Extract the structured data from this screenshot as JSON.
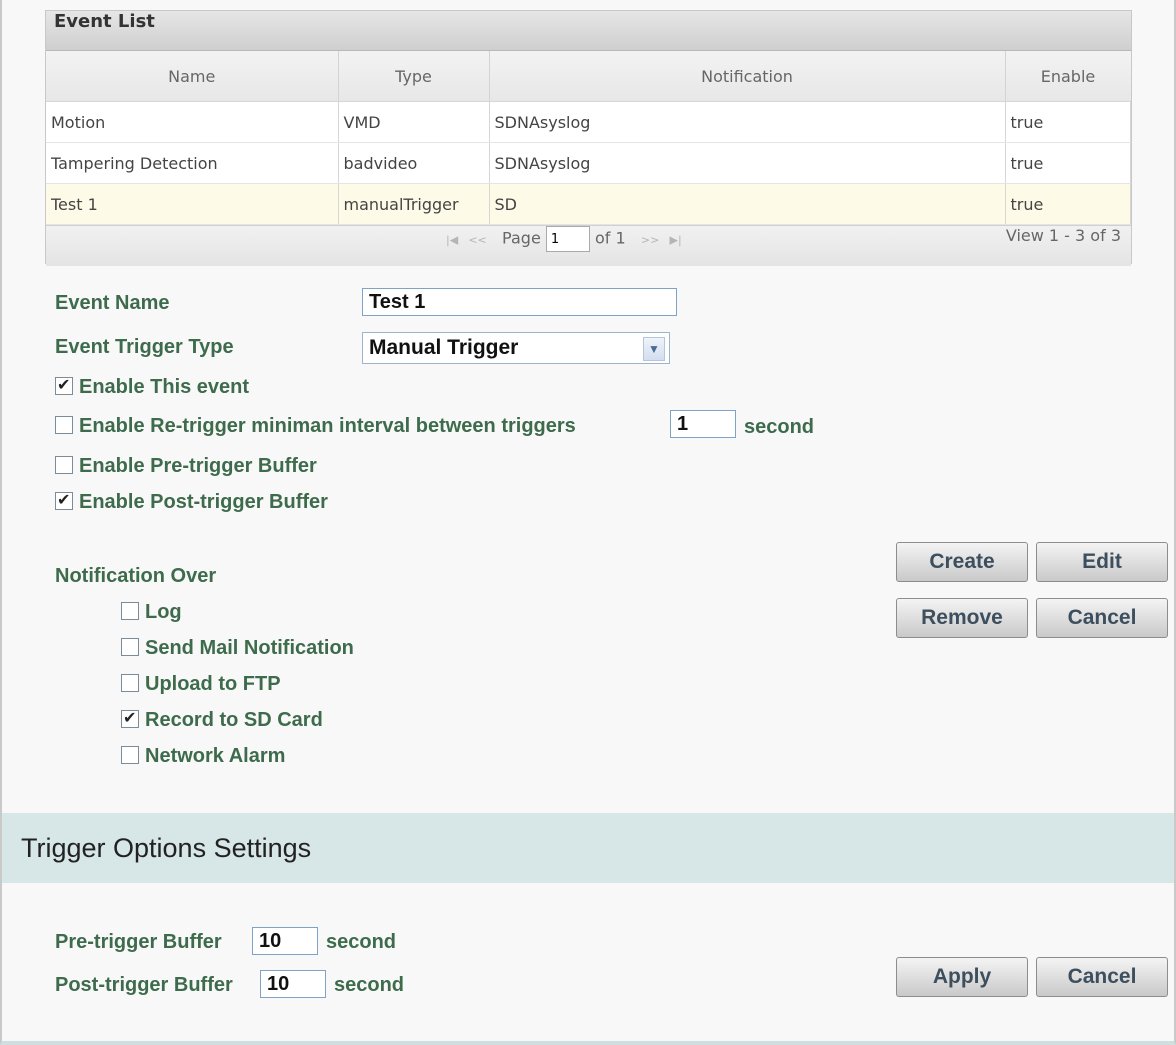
{
  "event_list": {
    "title": "Event List",
    "columns": [
      "Name",
      "Type",
      "Notification",
      "Enable"
    ],
    "rows": [
      {
        "name": "Motion",
        "type": "VMD",
        "notification": "SDNAsyslog",
        "enable": "true"
      },
      {
        "name": "Tampering Detection",
        "type": "badvideo",
        "notification": "SDNAsyslog",
        "enable": "true"
      },
      {
        "name": "Test 1",
        "type": "manualTrigger",
        "notification": "SD",
        "enable": "true"
      }
    ],
    "pager": {
      "page_label": "Page",
      "page_value": "1",
      "of_label": "of 1",
      "view_text": "View 1 - 3 of 3"
    }
  },
  "form": {
    "event_name_label": "Event Name",
    "event_name_value": "Test 1",
    "trigger_type_label": "Event Trigger Type",
    "trigger_type_value": "Manual Trigger",
    "enable_event_label": "Enable This event",
    "retrigger_label": "Enable Re-trigger miniman interval between triggers",
    "retrigger_value": "1",
    "retrigger_unit": "second",
    "pre_buffer_label": "Enable Pre-trigger Buffer",
    "post_buffer_label": "Enable Post-trigger Buffer",
    "notification_over_label": "Notification Over",
    "notify_log": "Log",
    "notify_mail": "Send Mail Notification",
    "notify_ftp": "Upload to FTP",
    "notify_sd": "Record to SD Card",
    "notify_alarm": "Network Alarm"
  },
  "buttons": {
    "create": "Create",
    "edit": "Edit",
    "remove": "Remove",
    "cancel": "Cancel",
    "apply": "Apply",
    "cancel2": "Cancel"
  },
  "trigger_options": {
    "title": "Trigger Options Settings",
    "pre_label": "Pre-trigger Buffer",
    "pre_value": "10",
    "post_label": "Post-trigger Buffer",
    "post_value": "10",
    "unit": "second"
  },
  "checkbox_states": {
    "enable_event": true,
    "retrigger": false,
    "pre_buffer": false,
    "post_buffer": true,
    "log": false,
    "mail": false,
    "ftp": false,
    "sd": true,
    "alarm": false
  }
}
